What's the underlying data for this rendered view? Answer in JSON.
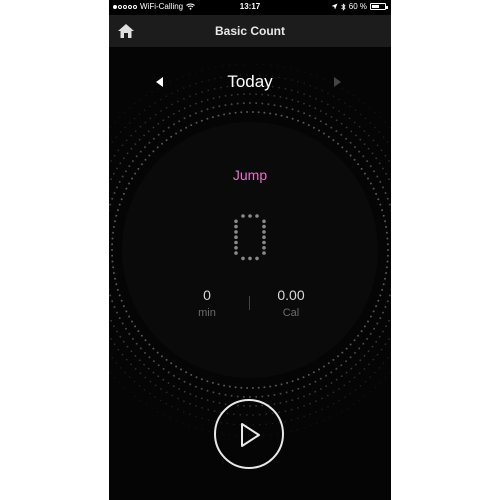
{
  "status_bar": {
    "carrier": "WiFi-Calling",
    "time": "13:17",
    "battery": "60 %",
    "battery_level": 0.6,
    "signal_bars_filled": 1
  },
  "nav": {
    "title": "Basic Count",
    "home_icon": "home-icon"
  },
  "date_nav": {
    "label": "Today",
    "prev_icon": "chevron-left-icon",
    "next_icon": "chevron-right-icon"
  },
  "activity": {
    "label": "Jump",
    "count": "0"
  },
  "stats": {
    "duration_value": "0",
    "duration_unit": "min",
    "calories_value": "0.00",
    "calories_unit": "Cal"
  },
  "controls": {
    "play_icon": "play-icon"
  },
  "colors": {
    "accent": "#e86fd0",
    "background": "#050505",
    "navbar": "#1c1c1c"
  }
}
